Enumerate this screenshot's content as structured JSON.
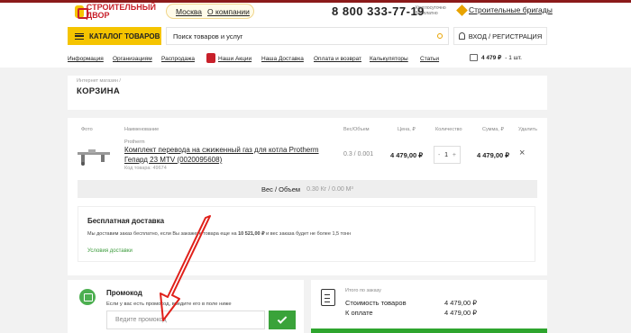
{
  "header": {
    "logo_line1": "СТРОИТЕЛЬНЫЙ",
    "logo_line2": "ДВОР",
    "city": "Москва",
    "about": "О компании",
    "phone": "8 800 333-77-19",
    "phone_note1": "Круглосуточно",
    "phone_note2": "Бесплатно",
    "brigades": "Строительные бригады"
  },
  "nav": {
    "catalog": "КАТАЛОГ ТОВАРОВ",
    "search_placeholder": "Поиск товаров и услуг",
    "login": "ВХОД / РЕГИСТРАЦИЯ",
    "links": [
      "Информация",
      "Организациям",
      "Распродажа",
      "Наши Акции",
      "Наша Доставка",
      "Оплата и возврат",
      "Калькуляторы",
      "Статьи"
    ],
    "cart_total": "4 479 ₽",
    "cart_qty": "- 1 шт."
  },
  "page": {
    "breadcrumb": "Интернет магазин /",
    "title": "КОРЗИНА"
  },
  "cart": {
    "headers": [
      "Фото",
      "Наименование",
      "Вес/Объем",
      "Цена, ₽",
      "Количество",
      "Сумма, ₽",
      "Удалить"
    ],
    "item": {
      "brand": "Protherm",
      "name": "Комплект перевода на сжиженный газ для котла Protherm Гепард 23 MTV (0020095608)",
      "code": "Код товара: 49674",
      "weight": "0.3 / 0.001",
      "price": "4 479,00 ₽",
      "qty": "1",
      "qty_minus": "-",
      "qty_plus": "+",
      "sum": "4 479,00 ₽",
      "delete": "×"
    },
    "weight_label": "Вес / Объем",
    "weight_value": "0.30 Кг / 0.00 М³"
  },
  "delivery": {
    "title": "Бесплатная доставка",
    "text_a": "Мы доставим заказ бесплатно, если Вы закажете товара еще на ",
    "text_amount": "10 521,00 ₽",
    "text_b": " и вес заказа будет не более 1,5 тонн",
    "link": "Условия доставки"
  },
  "promo": {
    "title": "Промокод",
    "text": "Если у вас есть промокод, введите его в поле ниже",
    "placeholder": "Ведите промокод"
  },
  "totals": {
    "label": "Итого по заказу",
    "cost_label": "Стоимость товаров",
    "cost_value": "4 479,00 ₽",
    "pay_label": "К оплате",
    "pay_value": "4 479,00 ₽"
  },
  "colors": {
    "accent": "#f5c400",
    "brand_red": "#c8202a",
    "success": "#2ea52e",
    "annotation_arrow": "#e0201a"
  }
}
